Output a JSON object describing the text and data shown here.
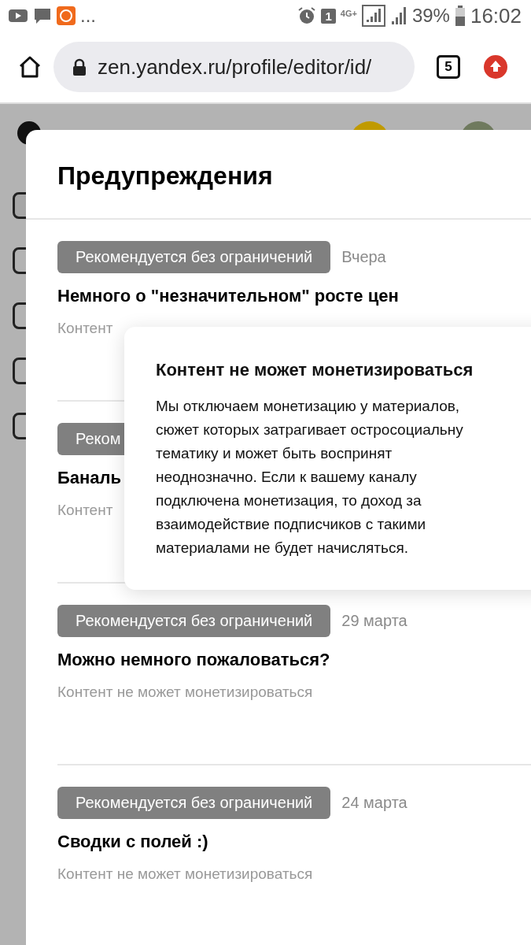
{
  "status_bar": {
    "more": "...",
    "sim": "1",
    "network": "4G+",
    "battery": "39%",
    "time": "16:02"
  },
  "browser": {
    "url": "zen.yandex.ru/profile/editor/id/",
    "tabs_count": "5"
  },
  "dialog": {
    "title": "Предупреждения",
    "items": [
      {
        "tag": "Рекомендуется без ограничений",
        "date": "Вчера",
        "title": "Немного о \"незначительном\" росте цен",
        "subtitle": "Контент"
      },
      {
        "tag": "Реком",
        "title": "Баналь",
        "subtitle": "Контент"
      },
      {
        "tag": "Рекомендуется без ограничений",
        "date": "29 марта",
        "title": "Можно немного пожаловаться?",
        "subtitle": "Контент не может монетизироваться"
      },
      {
        "tag": "Рекомендуется без ограничений",
        "date": "24 марта",
        "title": "Сводки с полей :)",
        "subtitle": "Контент не может монетизироваться"
      }
    ]
  },
  "tooltip": {
    "title": "Контент не может монетизироваться",
    "text": "Мы отключаем монетизацию у материалов,\nсюжет которых затрагивает остросоциальну\nтематику и может быть воспринят\nнеоднозначно. Если к вашему каналу\nподключена монетизация, то доход за\nвзаимодействие подписчиков с такими\nматериалами не будет начисляться."
  }
}
